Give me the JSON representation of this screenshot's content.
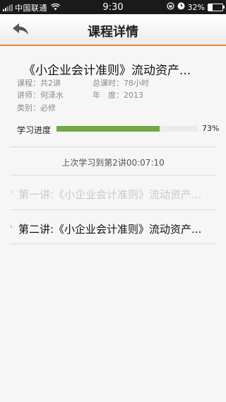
{
  "status_bar": {
    "carrier": "中国联通",
    "time": "9:30",
    "battery_percent": "32%",
    "battery_level": 0.32
  },
  "nav": {
    "title": "课程详情",
    "back_icon": "back-arrow-icon"
  },
  "course": {
    "title": "《小企业会计准则》流动资产...",
    "lessons_label": "课程：共2讲",
    "hours_label": "总课时：78小时",
    "teacher_label": "讲师：何泽水",
    "year_label": "年　度：2013",
    "category_label": "类别：必修"
  },
  "progress": {
    "label": "学习进度",
    "value": 0.73,
    "value_text": "73%",
    "color": "#73a845"
  },
  "last_study": "上次学习到第2讲00:07:10",
  "lectures": [
    {
      "title": "第一讲:《小企业会计准则》流动资产...",
      "state": "dim"
    },
    {
      "title": "第二讲:《小企业会计准则》流动资产...",
      "state": "active"
    }
  ],
  "colors": {
    "accent": "#f08a2b",
    "progress": "#73a845"
  }
}
